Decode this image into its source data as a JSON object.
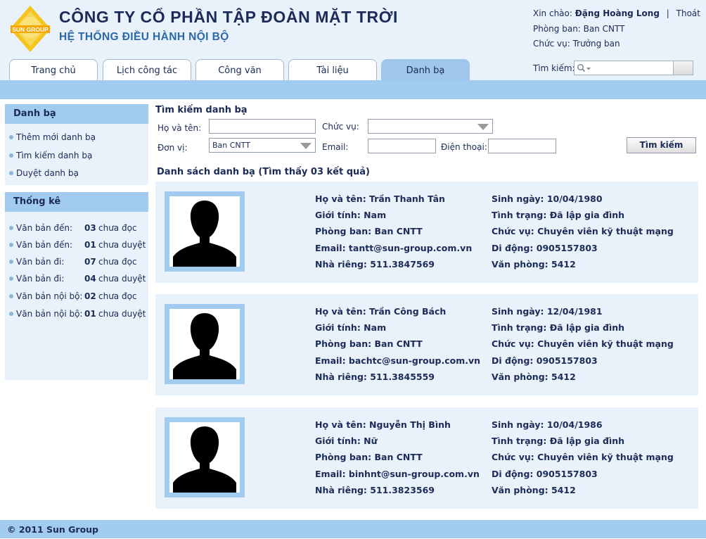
{
  "header": {
    "company_name": "CÔNG TY CỔ PHẦN TẬP ĐOÀN MẶT TRỜI",
    "system_name": "HỆ THỐNG ĐIỀU HÀNH NỘI BỘ",
    "logo_text": "SUN GROUP",
    "greeting_label": "Xin chào:",
    "user_name": "Đặng Hoàng Long",
    "separator": "|",
    "logout": "Thoát",
    "department_line": "Phòng ban: Ban CNTT",
    "position_line": "Chức vụ: Trưởng ban",
    "search_label": "Tìm kiếm:",
    "search_value": ""
  },
  "tabs": [
    {
      "label": "Trang chủ",
      "active": false
    },
    {
      "label": "Lịch công tác",
      "active": false
    },
    {
      "label": "Công văn",
      "active": false
    },
    {
      "label": "Tài liệu",
      "active": false
    },
    {
      "label": "Danh bạ",
      "active": true
    }
  ],
  "sidebar": {
    "contacts_title": "Danh bạ",
    "contacts_items": [
      "Thêm mới danh bạ",
      "Tìm kiếm danh bạ",
      "Duyệt danh bạ"
    ],
    "stats_title": "Thống kê",
    "stats": [
      {
        "label": "Văn bản đến:",
        "count": "03",
        "status": "chưa đọc"
      },
      {
        "label": "Văn bản đến:",
        "count": "01",
        "status": "chưa duyệt"
      },
      {
        "label": "Văn bản đi:",
        "count": "07",
        "status": "chưa đọc"
      },
      {
        "label": "Văn bản đi:",
        "count": "04",
        "status": "chưa duyệt"
      },
      {
        "label": "Văn bản nội bộ:",
        "count": "02",
        "status": "chưa đọc"
      },
      {
        "label": "Văn bản nội bộ:",
        "count": "01",
        "status": "chưa duyệt"
      }
    ]
  },
  "search_form": {
    "title": "Tìm kiếm danh bạ",
    "name_label": "Họ và tên:",
    "name_value": "",
    "position_label": "Chức vụ:",
    "position_value": "",
    "unit_label": "Đơn vị:",
    "unit_value": "Ban CNTT",
    "email_label": "Email:",
    "email_value": "",
    "phone_label": "Điện thoại:",
    "phone_value": "",
    "submit_label": "Tìm kiếm"
  },
  "results": {
    "title": "Danh sách danh bạ (Tìm thấy 03 kết quả)",
    "contacts": [
      {
        "name": "Họ và tên: Trần Thanh Tân",
        "gender": "Giới tính: Nam",
        "department": "Phòng ban: Ban CNTT",
        "email": "Email: tantt@sun-group.com.vn",
        "home_phone": "Nhà riêng: 511.3847569",
        "birthday": "Sinh ngày: 10/04/1980",
        "marital": "Tình trạng: Đã lập gia đình",
        "position": "Chức vụ: Chuyên viên kỹ thuật mạng",
        "mobile": "Di động: 0905157803",
        "office": "Văn phòng: 5412"
      },
      {
        "name": "Họ và tên: Trần Công Bách",
        "gender": "Giới tính: Nam",
        "department": "Phòng ban: Ban CNTT",
        "email": "Email: bachtc@sun-group.com.vn",
        "home_phone": "Nhà riêng: 511.3845559",
        "birthday": "Sinh ngày: 12/04/1981",
        "marital": "Tình trạng: Đã lập gia đình",
        "position": "Chức vụ: Chuyên viên kỹ thuật mạng",
        "mobile": "Di động: 0905157803",
        "office": "Văn phòng: 5412"
      },
      {
        "name": "Họ và tên: Nguyễn Thị Bình",
        "gender": "Giới tính: Nữ",
        "department": "Phòng ban: Ban CNTT",
        "email": "Email: binhnt@sun-group.com.vn",
        "home_phone": "Nhà riêng: 511.3823569",
        "birthday": "Sinh ngày: 10/04/1986",
        "marital": "Tình trạng: Đã lập gia đình",
        "position": "Chức vụ: Chuyên viên kỹ thuật mạng",
        "mobile": "Di động: 0905157803",
        "office": "Văn phòng: 5412"
      }
    ]
  },
  "footer": {
    "text": "© 2011 Sun Group"
  },
  "colors": {
    "accent_blue": "#a2cbf0",
    "panel_bg": "#e9f1fb",
    "text_dark": "#1c2b57",
    "subtitle_blue": "#2a68a8",
    "logo_yellow": "#f5c51e"
  }
}
